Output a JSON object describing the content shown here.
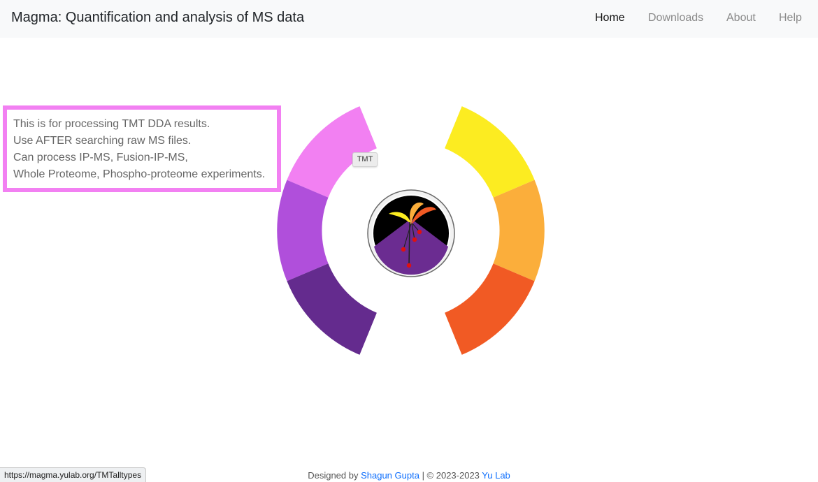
{
  "header": {
    "title": "Magma: Quantification and analysis of MS data",
    "nav": [
      {
        "label": "Home",
        "active": true
      },
      {
        "label": "Downloads",
        "active": false
      },
      {
        "label": "About",
        "active": false
      },
      {
        "label": "Help",
        "active": false
      }
    ]
  },
  "info_box": {
    "lines": [
      "This is for processing TMT DDA results.",
      "Use AFTER searching raw MS files.",
      "Can process IP-MS, Fusion-IP-MS,",
      "Whole Proteome, Phospho-proteome experiments."
    ],
    "border_color": "#f280f2"
  },
  "wheel": {
    "hovered_segment_tooltip": "TMT",
    "segment_colors": [
      "#f280f2",
      "#b04fdb",
      "#642b8e",
      "#fcec21",
      "#fbae3b",
      "#f15a24"
    ],
    "logo": {
      "name": "magma-logo"
    }
  },
  "status_bar": {
    "url": "https://magma.yulab.org/TMTalltypes"
  },
  "footer": {
    "prefix": "Designed by ",
    "author": "Shagun Gupta",
    "middle": " | © 2023-2023 ",
    "lab": "Yu Lab"
  }
}
